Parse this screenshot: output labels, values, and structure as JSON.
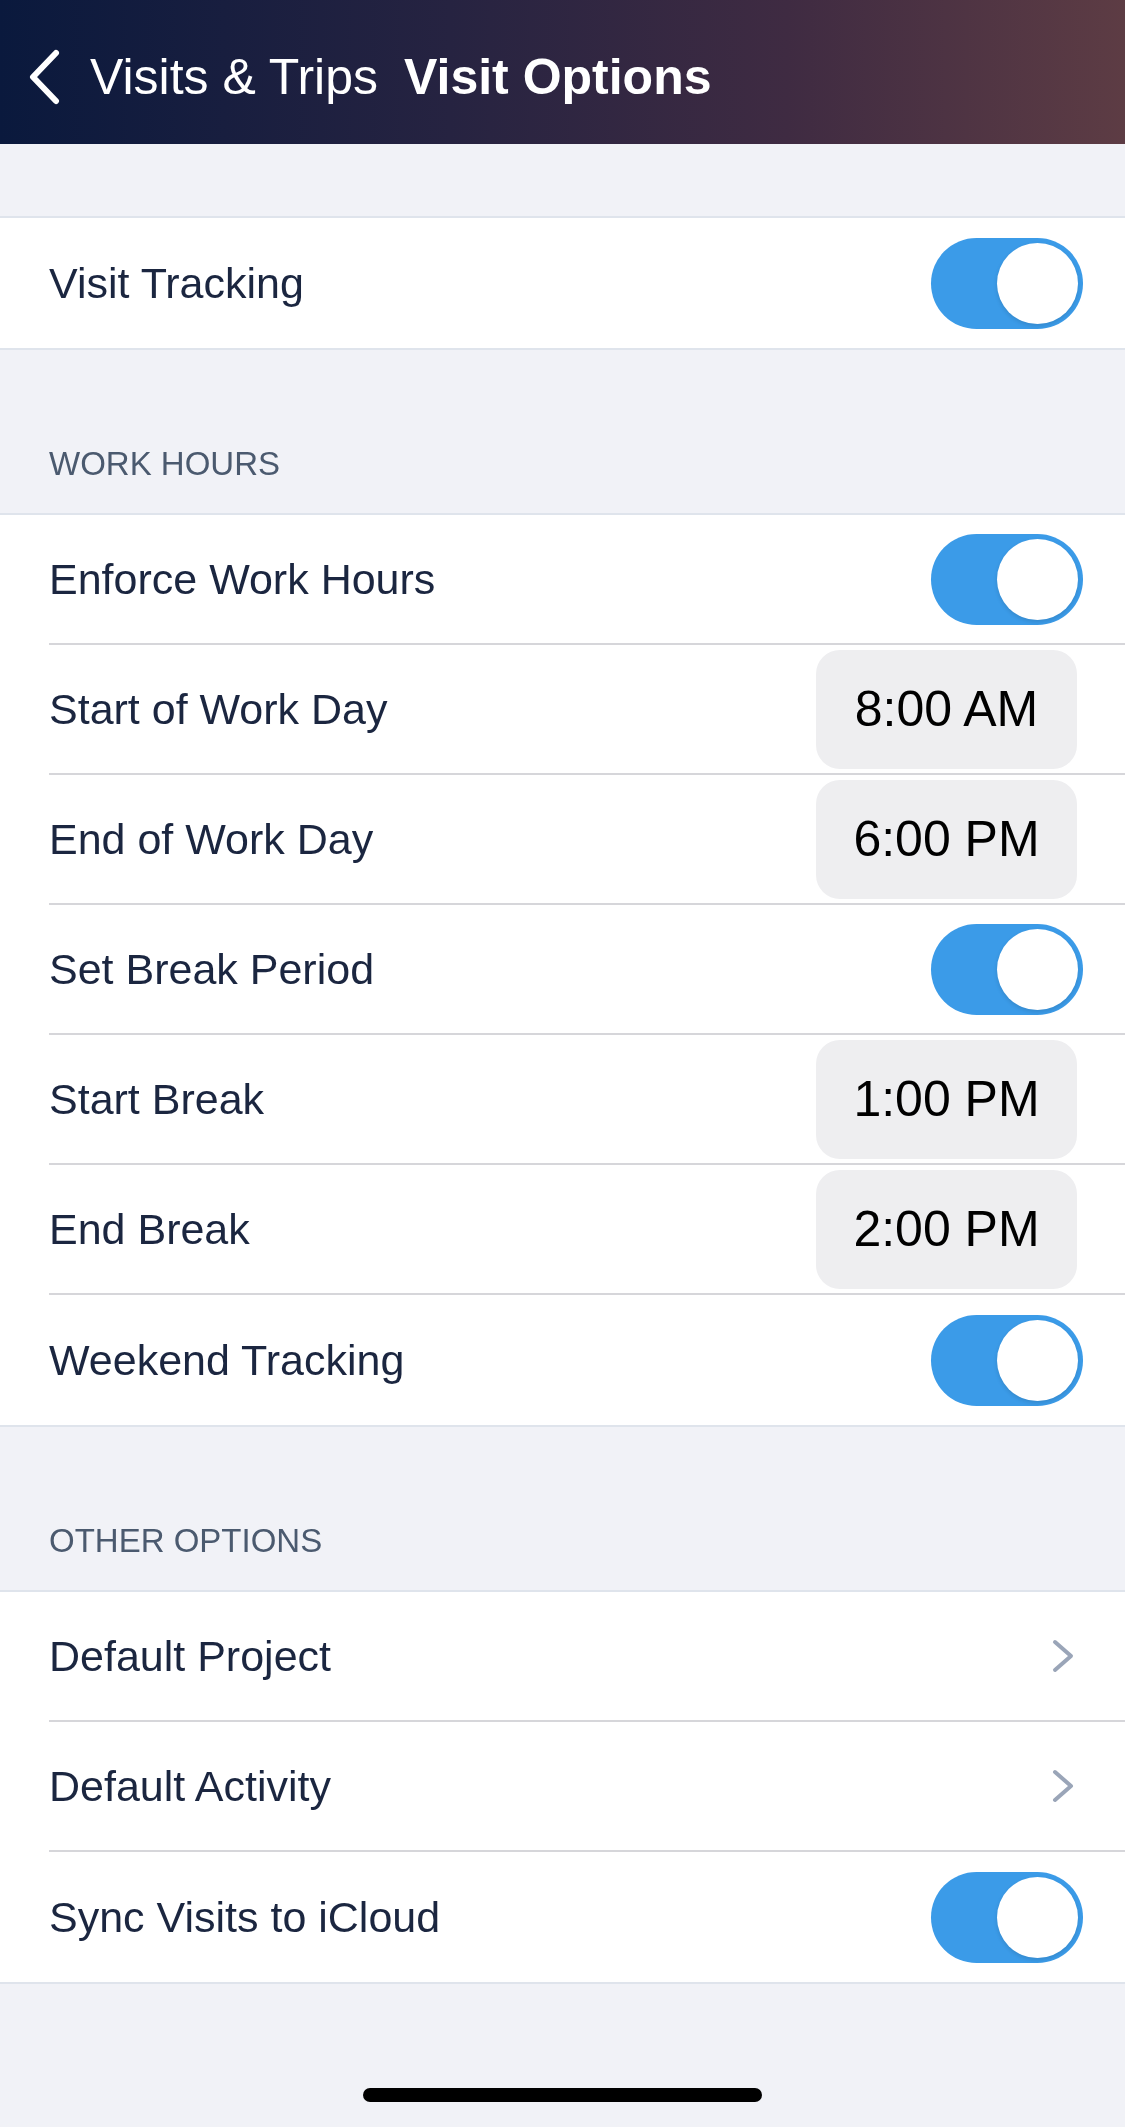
{
  "nav_bar": {
    "back_label": "Visits & Trips",
    "title": "Visit Options"
  },
  "sections": [
    {
      "rows": [
        {
          "kind": "toggle",
          "label": "Visit Tracking",
          "on": true
        }
      ]
    },
    {
      "header": "WORK HOURS",
      "rows": [
        {
          "kind": "toggle",
          "label": "Enforce Work Hours",
          "on": true
        },
        {
          "kind": "time",
          "label": "Start of Work Day",
          "value": "8:00 AM"
        },
        {
          "kind": "time",
          "label": "End of Work Day",
          "value": "6:00 PM"
        },
        {
          "kind": "toggle",
          "label": "Set Break Period",
          "on": true
        },
        {
          "kind": "time",
          "label": "Start Break",
          "value": "1:00 PM"
        },
        {
          "kind": "time",
          "label": "End Break",
          "value": "2:00 PM"
        },
        {
          "kind": "toggle",
          "label": "Weekend Tracking",
          "on": true
        }
      ]
    },
    {
      "header": "OTHER OPTIONS",
      "rows": [
        {
          "kind": "link",
          "label": "Default Project"
        },
        {
          "kind": "link",
          "label": "Default Activity"
        },
        {
          "kind": "toggle",
          "label": "Sync Visits to iCloud",
          "on": true
        }
      ]
    }
  ]
}
